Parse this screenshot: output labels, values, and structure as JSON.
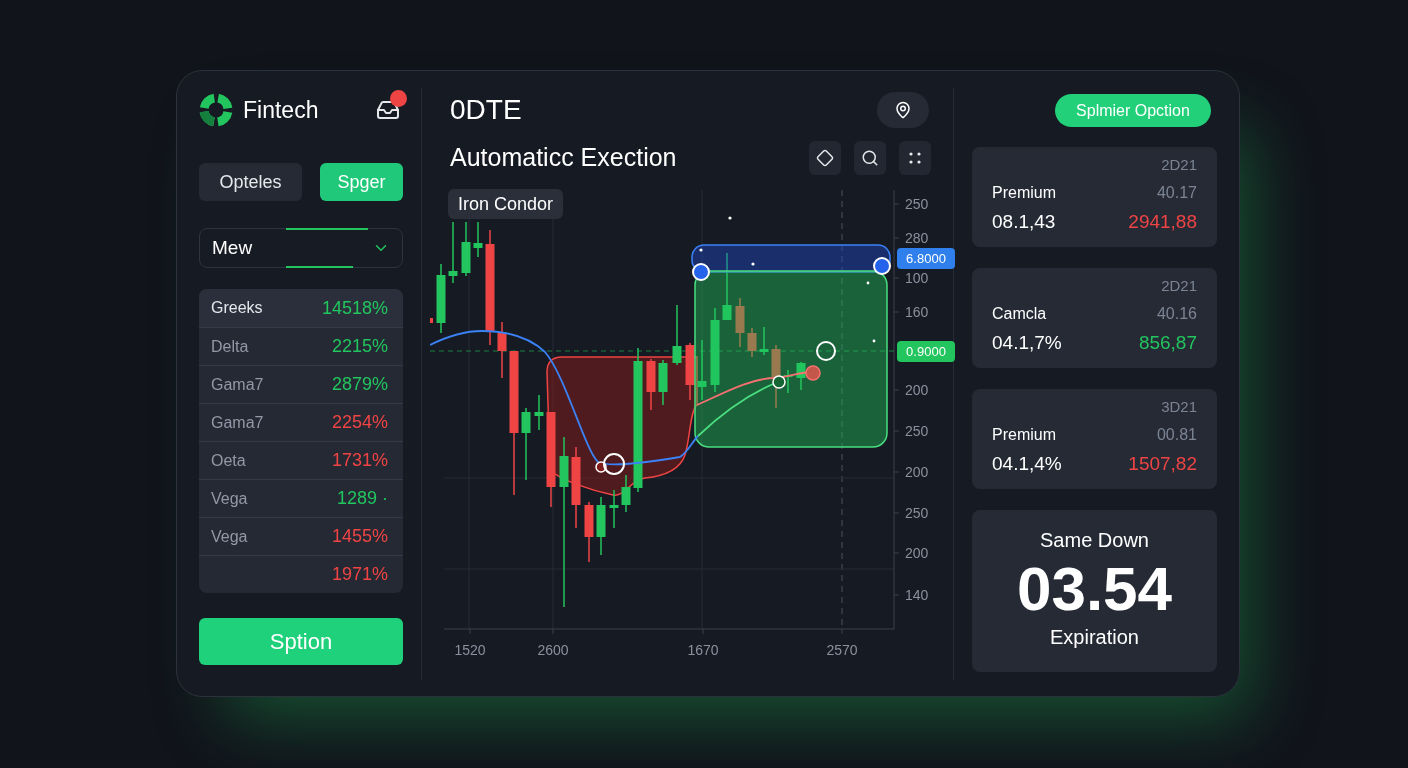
{
  "sidebar": {
    "brand": "Fintech",
    "has_notification": true,
    "tabs": [
      {
        "label": "Opteles",
        "selected": false
      },
      {
        "label": "Spger",
        "selected": true
      }
    ],
    "dropdown": {
      "value": "Mew"
    },
    "greeks": [
      {
        "kind": "header",
        "label": "Greeks",
        "value": "14518%",
        "color": "#22c55e"
      },
      {
        "kind": "row",
        "label": "Delta",
        "value": "2215%",
        "color": "#22c55e"
      },
      {
        "kind": "row",
        "label": "Gama7",
        "value": "2879%",
        "color": "#22c55e"
      },
      {
        "kind": "row",
        "label": "Gama7",
        "value": "2254%",
        "color": "#ef4444"
      },
      {
        "kind": "row",
        "label": "Oeta",
        "value": "1731%",
        "color": "#ef4444"
      },
      {
        "kind": "row",
        "label": "Vega",
        "value": "1289 ·",
        "color": "#22c55e"
      },
      {
        "kind": "row",
        "label": "Vega",
        "value": "1455%",
        "color": "#ef4444"
      },
      {
        "kind": "row",
        "value": "1971%",
        "color": "#ef4444"
      }
    ],
    "action_button": "Sption"
  },
  "main": {
    "title": "0DTE",
    "subtitle": "Automaticc Exection",
    "strategy_tag": "Iron Condor",
    "chart": {
      "y_axis_labels": [
        "250",
        "280",
        "100",
        "160",
        "200",
        "250",
        "200",
        "250",
        "200",
        "140"
      ],
      "x_axis_labels": [
        "1520",
        "2600",
        "1670",
        "2570"
      ],
      "price_tags": [
        {
          "label": "6.8000",
          "color": "#2f80ed"
        },
        {
          "label": "0.9000",
          "color": "#22c55e"
        }
      ]
    }
  },
  "panel": {
    "button": "Splmier Opction",
    "quotes": [
      {
        "code": "2D21",
        "name": "Premium",
        "reference": "40.17",
        "value": "08.1,43",
        "change": "2941,88",
        "color": "#ef4444"
      },
      {
        "code": "2D21",
        "name": "Camcla",
        "reference": "40.16",
        "value": "04.1,7%",
        "change": "856,87",
        "color": "#22c55e"
      },
      {
        "code": "3D21",
        "name": "Premium",
        "reference": "00.81",
        "value": "04.1,4%",
        "change": "1507,82",
        "color": "#ef4444"
      }
    ],
    "expiry": {
      "title": "Same Down",
      "time": "03.54",
      "caption": "Expiration"
    }
  }
}
